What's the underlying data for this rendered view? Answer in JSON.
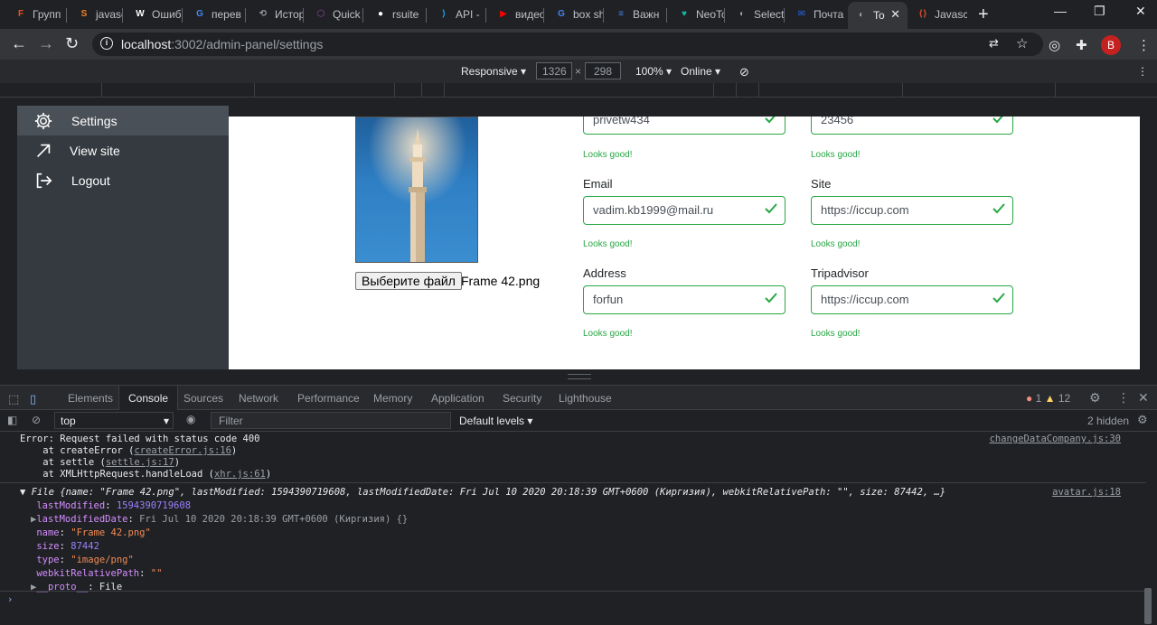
{
  "tabs": [
    {
      "label": "Групп",
      "color": "#f24e1e",
      "glyph": "F"
    },
    {
      "label": "javasc",
      "color": "#f48024",
      "glyph": "S"
    },
    {
      "label": "Ошиб",
      "color": "#ffffff",
      "glyph": "W"
    },
    {
      "label": "перев",
      "color": "#4285f4",
      "glyph": "G"
    },
    {
      "label": "Истор",
      "color": "#9aa0a6",
      "glyph": "⟲"
    },
    {
      "label": "Quick",
      "color": "#8e44ad",
      "glyph": "⬡"
    },
    {
      "label": "rsuite",
      "color": "#ffffff",
      "glyph": "●"
    },
    {
      "label": "API -",
      "color": "#0ea5e9",
      "glyph": "⟩"
    },
    {
      "label": "видео",
      "color": "#ff0000",
      "glyph": "▶"
    },
    {
      "label": "box sh",
      "color": "#4285f4",
      "glyph": "G"
    },
    {
      "label": "Важн",
      "color": "#4285f4",
      "glyph": "≡"
    },
    {
      "label": "NeoTo",
      "color": "#14b8a6",
      "glyph": "♥"
    },
    {
      "label": "Select",
      "color": "#9aa0a6",
      "glyph": "◐"
    },
    {
      "label": "Почта",
      "color": "#2563eb",
      "glyph": "✉"
    },
    {
      "label": "To",
      "color": "#9aa0a6",
      "glyph": "◐"
    },
    {
      "label": "Javasc",
      "color": "#e44d26",
      "glyph": "⟨⟩"
    }
  ],
  "address": {
    "host": "localhost",
    "path": ":3002/admin-panel/settings"
  },
  "profile_initial": "B",
  "device_toolbar": {
    "mode": "Responsive",
    "width": "1326",
    "height": "298",
    "zoom": "100%",
    "network": "Online"
  },
  "sidebar": {
    "items": [
      {
        "label": "Settings",
        "icon": "gear-icon"
      },
      {
        "label": "View site",
        "icon": "arrow-up-right-icon"
      },
      {
        "label": "Logout",
        "icon": "logout-icon"
      }
    ]
  },
  "avatar_form": {
    "choose_file": "Выберите файл",
    "file_name": "Frame 42.png"
  },
  "fields": {
    "top_left": {
      "value": "privetw434",
      "valid": "Looks good!"
    },
    "top_right": {
      "value": "23456",
      "valid": "Looks good!"
    },
    "email": {
      "label": "Email",
      "value": "vadim.kb1999@mail.ru",
      "valid": "Looks good!"
    },
    "site": {
      "label": "Site",
      "value": "https://iccup.com",
      "valid": "Looks good!"
    },
    "address": {
      "label": "Address",
      "value": "forfun",
      "valid": "Looks good!"
    },
    "tripadvisor": {
      "label": "Tripadvisor",
      "value": "https://iccup.com",
      "valid": "Looks good!"
    }
  },
  "devtools": {
    "tabs": [
      "Elements",
      "Console",
      "Sources",
      "Network",
      "Performance",
      "Memory",
      "Application",
      "Security",
      "Lighthouse"
    ],
    "errors": "1",
    "warnings": "12",
    "context": "top",
    "filter_placeholder": "Filter",
    "levels": "Default levels",
    "hidden": "2 hidden"
  },
  "console": {
    "error_lines": [
      "Error: Request failed with status code 400",
      "    at createError (createError.js:16)",
      "    at settle (settle.js:17)",
      "    at XMLHttpRequest.handleLoad (xhr.js:61)"
    ],
    "error_source": "changeDataCompany.js:30",
    "file_summary": "File {name: \"Frame 42.png\", lastModified: 1594390719608, lastModifiedDate: Fri Jul 10 2020 20:18:39 GMT+0600 (Киргизия), webkitRelativePath: \"\", size: 87442, …}",
    "file_source": "avatar.js:18",
    "props": [
      {
        "key": "lastModified",
        "value": "1594390719608",
        "kind": "num",
        "arrow": ""
      },
      {
        "key": "lastModifiedDate",
        "value": "Fri Jul 10 2020 20:18:39 GMT+0600 (Киргизия) {}",
        "kind": "gray",
        "arrow": "▶"
      },
      {
        "key": "name",
        "value": "\"Frame 42.png\"",
        "kind": "str",
        "arrow": ""
      },
      {
        "key": "size",
        "value": "87442",
        "kind": "num",
        "arrow": ""
      },
      {
        "key": "type",
        "value": "\"image/png\"",
        "kind": "str",
        "arrow": ""
      },
      {
        "key": "webkitRelativePath",
        "value": "\"\"",
        "kind": "str",
        "arrow": ""
      },
      {
        "key": "__proto__",
        "value": "File",
        "kind": "plain",
        "arrow": "▶"
      }
    ]
  }
}
